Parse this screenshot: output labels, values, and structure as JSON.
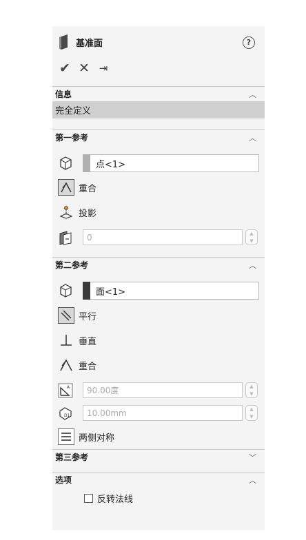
{
  "header": {
    "title": "基准面",
    "help": "?"
  },
  "actions": {
    "ok": "✔",
    "cancel": "✕",
    "pin": "⇥"
  },
  "info": {
    "header": "信息",
    "status": "完全定义"
  },
  "ref1": {
    "header": "第一参考",
    "selection": "点<1>",
    "swatch_color": "#b0b0b0",
    "options": [
      "重合",
      "投影"
    ],
    "value": "0"
  },
  "ref2": {
    "header": "第二参考",
    "selection": "面<1>",
    "swatch_color": "#3a3a3a",
    "options": [
      "平行",
      "垂直",
      "重合"
    ],
    "angle": "90.00度",
    "distance": "10.00mm",
    "symmetric": "两侧对称"
  },
  "ref3": {
    "header": "第三参考"
  },
  "options_section": {
    "header": "选项",
    "flip_normal": "反转法线"
  },
  "chevrons": {
    "up": "︿",
    "down": "﹀"
  }
}
